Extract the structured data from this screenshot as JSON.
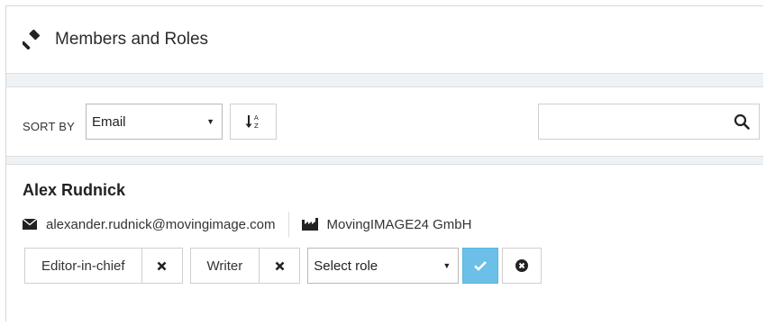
{
  "header": {
    "title": "Members and Roles",
    "icon": "gavel-icon"
  },
  "sort": {
    "label": "SORT BY",
    "selected": "Email",
    "order_icon": "sort-alpha-asc-icon"
  },
  "search": {
    "value": "",
    "icon": "search-icon"
  },
  "member": {
    "name": "Alex Rudnick",
    "email": "alexander.rudnick@movingimage.com",
    "company": "MovingIMAGE24 GmbH",
    "roles": [
      {
        "label": "Editor-in-chief"
      },
      {
        "label": "Writer"
      }
    ],
    "role_select": "Select role"
  },
  "colors": {
    "accent": "#6cc0e8",
    "band": "#eef2f5"
  }
}
